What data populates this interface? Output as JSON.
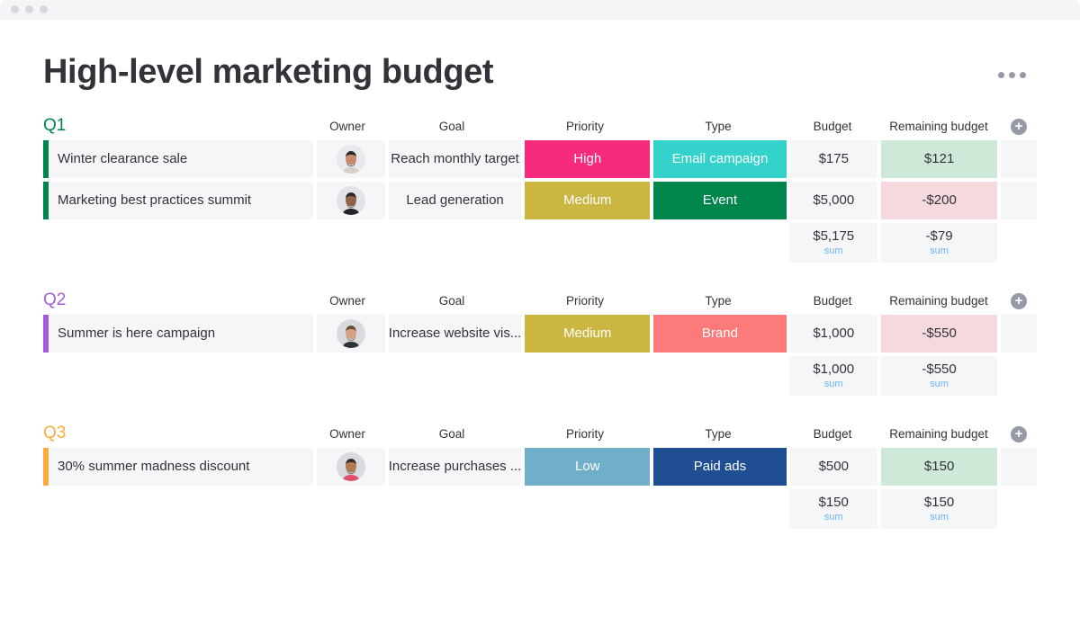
{
  "window": {
    "traffic_lights": [
      "close",
      "minimize",
      "maximize"
    ]
  },
  "header": {
    "title": "High-level marketing budget",
    "menu_icon": "kebab-menu-icon"
  },
  "columns": {
    "name": "",
    "owner": "Owner",
    "goal": "Goal",
    "priority": "Priority",
    "type": "Type",
    "budget": "Budget",
    "remaining": "Remaining budget",
    "add": "add-column-icon"
  },
  "labels": {
    "sum": "sum",
    "add_plus": "+"
  },
  "colors": {
    "q1": "#00854d",
    "q2": "#a25ddc",
    "q3": "#fdab3d",
    "priority_high": "#f62b7d",
    "priority_medium": "#cab641",
    "priority_low": "#6fafc9",
    "type_email": "#33d2cb",
    "type_event": "#00854d",
    "type_brand": "#fc7a7a",
    "type_paid_ads": "#1f4e93",
    "positive_bg": "#cfe9d8",
    "negative_bg": "#f6d9de",
    "cell_bg": "#f5f6f8",
    "sum_label": "#6ab4f8",
    "text": "#323338"
  },
  "groups": [
    {
      "title": "Q1",
      "color": "#00854d",
      "items": [
        {
          "name": "Winter clearance sale",
          "owner_avatar": "avatar-woman-headscarf",
          "goal": "Reach monthly target",
          "priority": "High",
          "priority_color": "#f62b7d",
          "type": "Email campaign",
          "type_color": "#33d2cb",
          "budget": "$175",
          "remaining": "$121",
          "remaining_state": "positive"
        },
        {
          "name": "Marketing best practices summit",
          "owner_avatar": "avatar-man-beard-dark",
          "goal": "Lead generation",
          "priority": "Medium",
          "priority_color": "#cab641",
          "type": "Event",
          "type_color": "#00854d",
          "budget": "$5,000",
          "remaining": "-$200",
          "remaining_state": "negative"
        }
      ],
      "summary": {
        "budget": "$5,175",
        "budget_label": "sum",
        "remaining": "-$79",
        "remaining_label": "sum"
      }
    },
    {
      "title": "Q2",
      "color": "#a25ddc",
      "items": [
        {
          "name": "Summer is here campaign",
          "owner_avatar": "avatar-man-short-hair",
          "goal": "Increase website vis...",
          "priority": "Medium",
          "priority_color": "#cab641",
          "type": "Brand",
          "type_color": "#fc7a7a",
          "budget": "$1,000",
          "remaining": "-$550",
          "remaining_state": "negative"
        }
      ],
      "summary": {
        "budget": "$1,000",
        "budget_label": "sum",
        "remaining": "-$550",
        "remaining_label": "sum"
      }
    },
    {
      "title": "Q3",
      "color": "#fdab3d",
      "items": [
        {
          "name": "30% summer madness discount",
          "owner_avatar": "avatar-man-beard-colorful",
          "goal": "Increase purchases ...",
          "priority": "Low",
          "priority_color": "#6fafc9",
          "type": "Paid ads",
          "type_color": "#1f4e93",
          "budget": "$500",
          "remaining": "$150",
          "remaining_state": "positive"
        }
      ],
      "summary": {
        "budget": "$150",
        "budget_label": "sum",
        "remaining": "$150",
        "remaining_label": "sum"
      }
    }
  ]
}
